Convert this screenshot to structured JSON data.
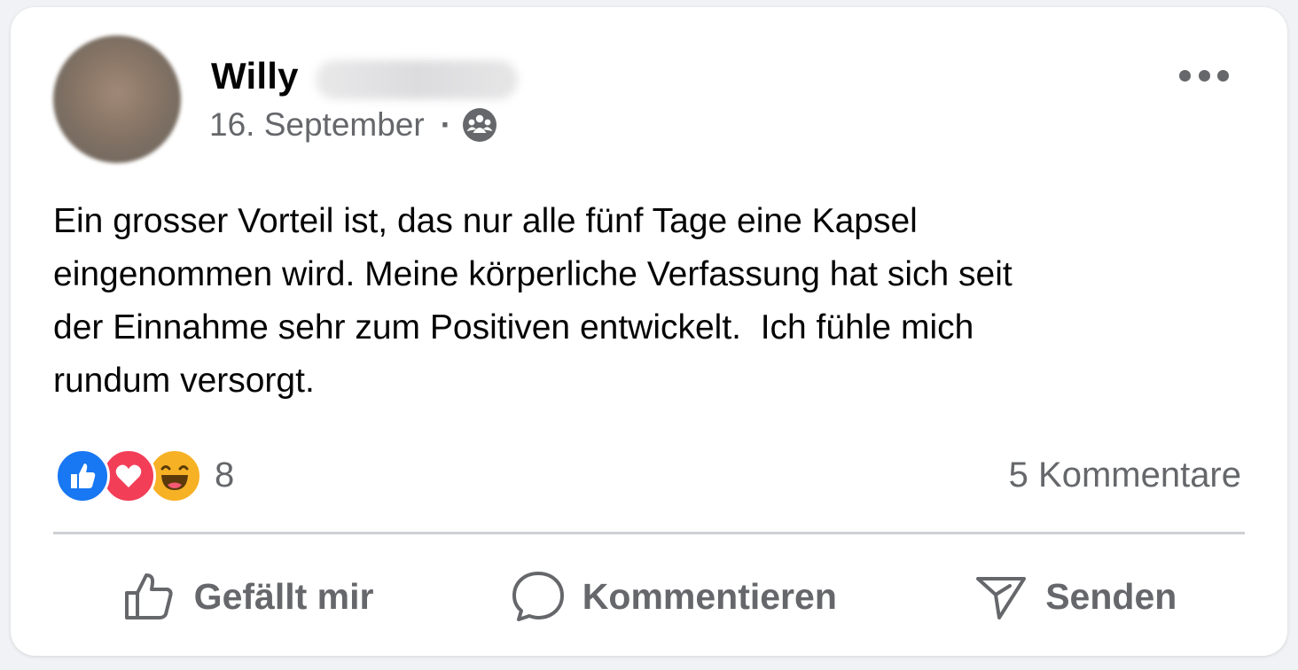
{
  "post": {
    "author_first": "Willy",
    "date": "16. September",
    "separator": "·",
    "privacy_icon": "group-icon",
    "text": "Ein grosser Vorteil ist, das nur alle fünf Tage eine Kapsel\neingenommen wird. Meine körperliche Verfassung hat sich seit\nder Einnahme sehr zum Positiven entwickelt.  Ich fühle mich\nrundum versorgt."
  },
  "reactions": {
    "icons": [
      "like-reaction-icon",
      "love-reaction-icon",
      "haha-reaction-icon"
    ],
    "count": "8",
    "comments": "5 Kommentare"
  },
  "actions": {
    "like": "Gefällt mir",
    "comment": "Kommentieren",
    "share": "Senden"
  },
  "colors": {
    "background": "#f0f2f5",
    "card": "#ffffff",
    "secondary_text": "#65676b",
    "like_blue": "#1877f2",
    "love_red": "#f33e58",
    "haha_yellow": "#f7b125"
  }
}
